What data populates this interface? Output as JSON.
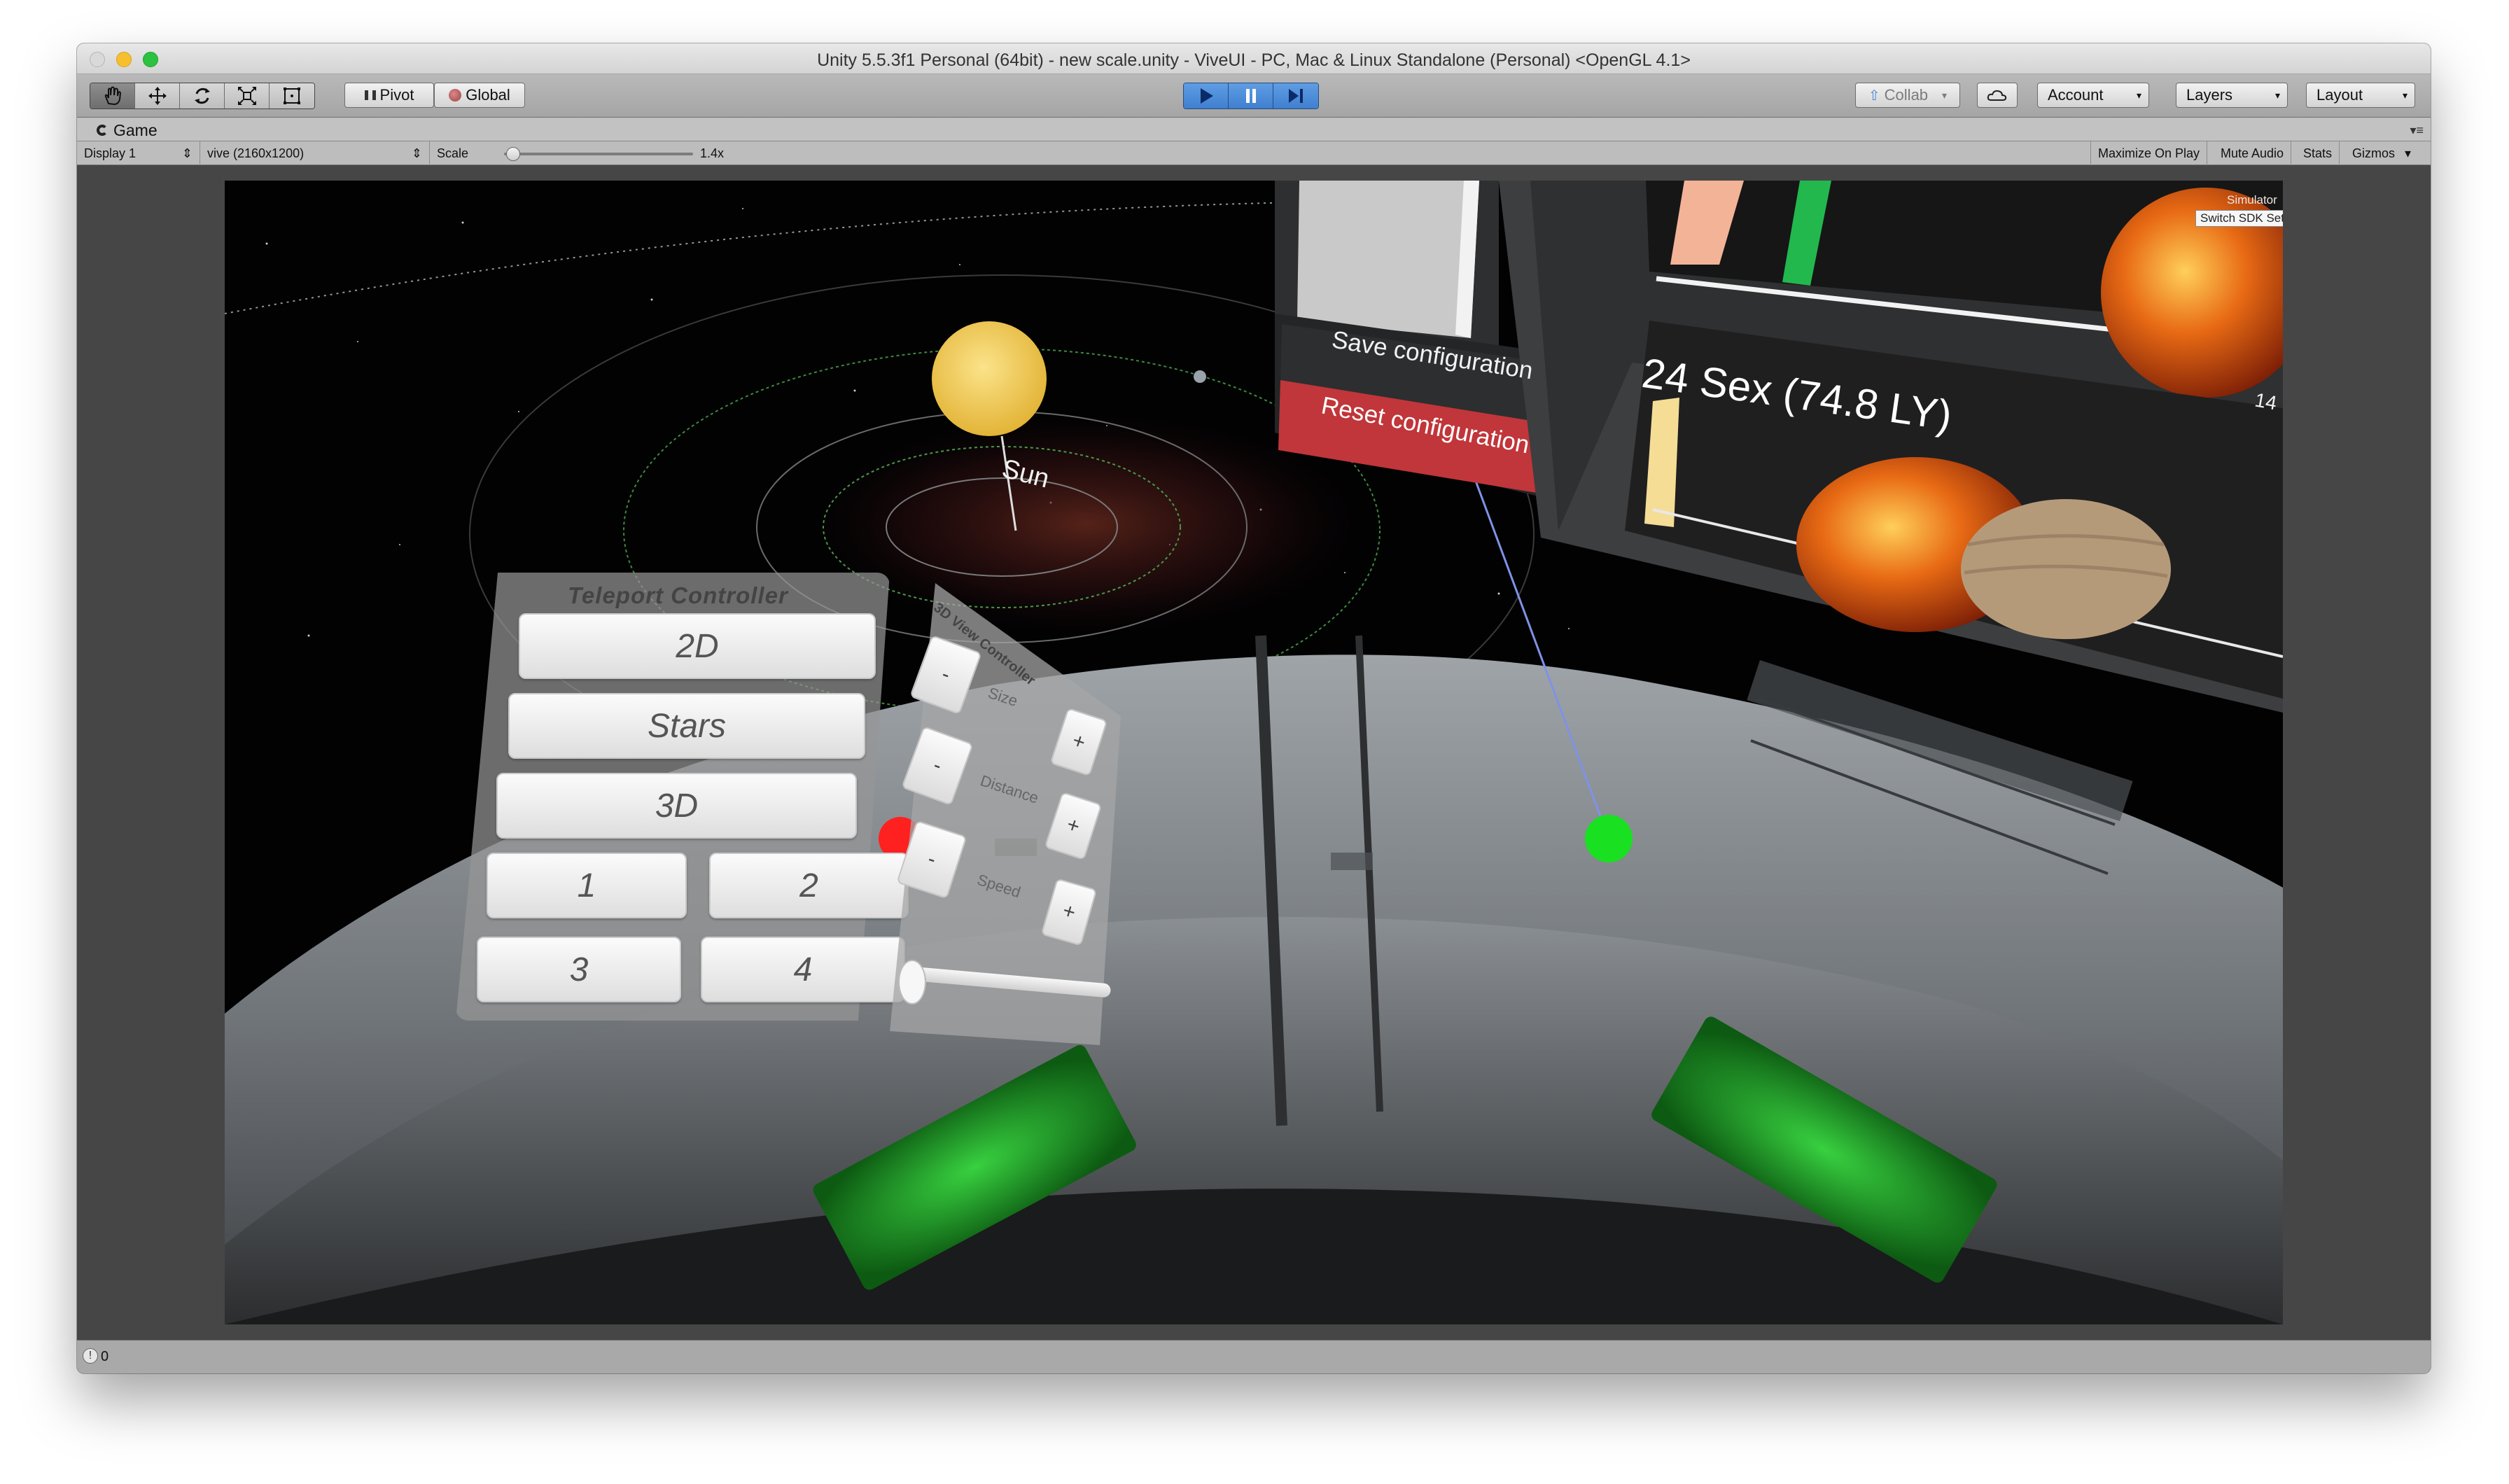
{
  "window": {
    "title": "Unity 5.5.3f1 Personal (64bit) - new scale.unity - ViveUI - PC, Mac & Linux Standalone (Personal) <OpenGL 4.1>"
  },
  "toolbar": {
    "tools": [
      {
        "name": "hand-tool-icon"
      },
      {
        "name": "move-tool-icon"
      },
      {
        "name": "rotate-tool-icon"
      },
      {
        "name": "scale-tool-icon"
      },
      {
        "name": "rect-tool-icon"
      }
    ],
    "pivot_label": "Pivot",
    "global_label": "Global",
    "collab_label": "Collab",
    "account_label": "Account",
    "layers_label": "Layers",
    "layout_label": "Layout"
  },
  "game_view": {
    "tab_label": "Game",
    "display_label": "Display 1",
    "resolution_label": "vive (2160x1200)",
    "scale_label": "Scale",
    "scale_value": "1.4x",
    "scale_fraction": 0.02,
    "maximize_label": "Maximize On Play",
    "mute_label": "Mute Audio",
    "stats_label": "Stats",
    "gizmos_label": "Gizmos"
  },
  "scene": {
    "sun_label": "Sun",
    "teleport": {
      "title": "Teleport Controller",
      "buttons": [
        "2D",
        "Stars",
        "3D",
        "1",
        "2",
        "3",
        "4"
      ]
    },
    "view_controller": {
      "title": "3D View Controller",
      "rows": [
        {
          "minus": "-",
          "label": "Size",
          "plus": "+"
        },
        {
          "minus": "-",
          "label": "Distance",
          "plus": "+"
        },
        {
          "minus": "-",
          "label": "Speed",
          "plus": "+"
        }
      ]
    },
    "config": {
      "save_label": "Save configuration",
      "reset_label": "Reset configuration"
    },
    "star_label": "24 Sex (74.8 LY)",
    "simulator_label": "Simulator",
    "switch_sdk_label": "Switch SDK Setup",
    "corner_number": "14"
  },
  "status": {
    "count": "0"
  },
  "colors": {
    "play_blue": "#4a8be0",
    "reset_red": "#c0363a",
    "pointer_green": "#19e021",
    "pointer_red": "#ff2020"
  }
}
